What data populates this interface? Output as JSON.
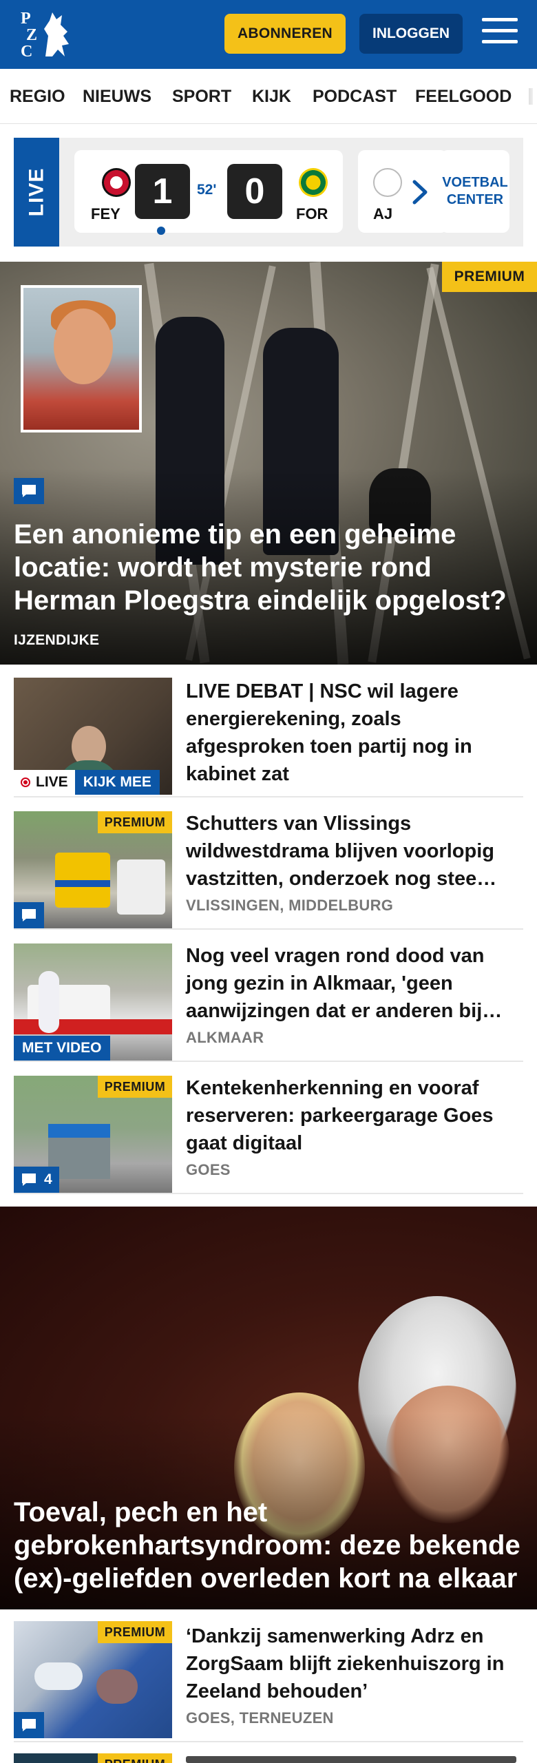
{
  "header": {
    "brand": "PZC",
    "subscribe_label": "ABONNEREN",
    "login_label": "INLOGGEN",
    "brand_color": "#0c56a6",
    "accent_color": "#f4c118"
  },
  "nav": {
    "items": [
      "REGIO",
      "NIEUWS",
      "SPORT",
      "KIJK",
      "PODCAST",
      "FEELGOOD"
    ]
  },
  "live": {
    "label": "LIVE",
    "match": {
      "home_team": "FEY",
      "away_team": "FOR",
      "home_score": "1",
      "away_score": "0",
      "minute": "52'"
    },
    "next_team": "AJ",
    "voetbal_center_label": "VOETBAL CENTER"
  },
  "hero": {
    "badge": "PREMIUM",
    "title": "Een anonieme tip en een geheime locatie: wordt het mysterie rond Herman Ploegstra eindelijk opgelost?",
    "location": "IJZENDIJKE"
  },
  "articles": [
    {
      "title": "LIVE DEBAT | NSC wil lagere energierekening, zoals afgesproken toen partij nog in kabinet zat",
      "live_label": "LIVE",
      "watch_label": "KIJK MEE"
    },
    {
      "badge": "PREMIUM",
      "title": "Schutters van Vlissings wildwestdrama blijven voorlopig vastzitten, onderzoek nog stee…",
      "location": "VLISSINGEN, MIDDELBURG"
    },
    {
      "title": "Nog veel vragen rond dood van jong gezin in Alkmaar, 'geen aanwijzingen dat er anderen bij…",
      "location": "ALKMAAR",
      "video_label": "MET VIDEO"
    },
    {
      "badge": "PREMIUM",
      "title": "Kentekenherkenning en vooraf reserveren: parkeergarage Goes gaat digitaal",
      "location": "GOES",
      "comment_count": "4"
    }
  ],
  "hero2": {
    "title": "Toeval, pech en het gebrokenhartsyndroom: deze bekende (ex)-geliefden overleden kort na elkaar"
  },
  "articles2": [
    {
      "badge": "PREMIUM",
      "title": "‘Dankzij samenwerking Adrz en ZorgSaam blijft ziekenhuiszorg in Zeeland behouden’",
      "location": "GOES, TERNEUZEN"
    },
    {
      "badge": "PREMIUM"
    }
  ],
  "icons": [
    "logo-icon",
    "menu-icon",
    "comment-icon",
    "chevron-right-icon",
    "record-icon"
  ]
}
